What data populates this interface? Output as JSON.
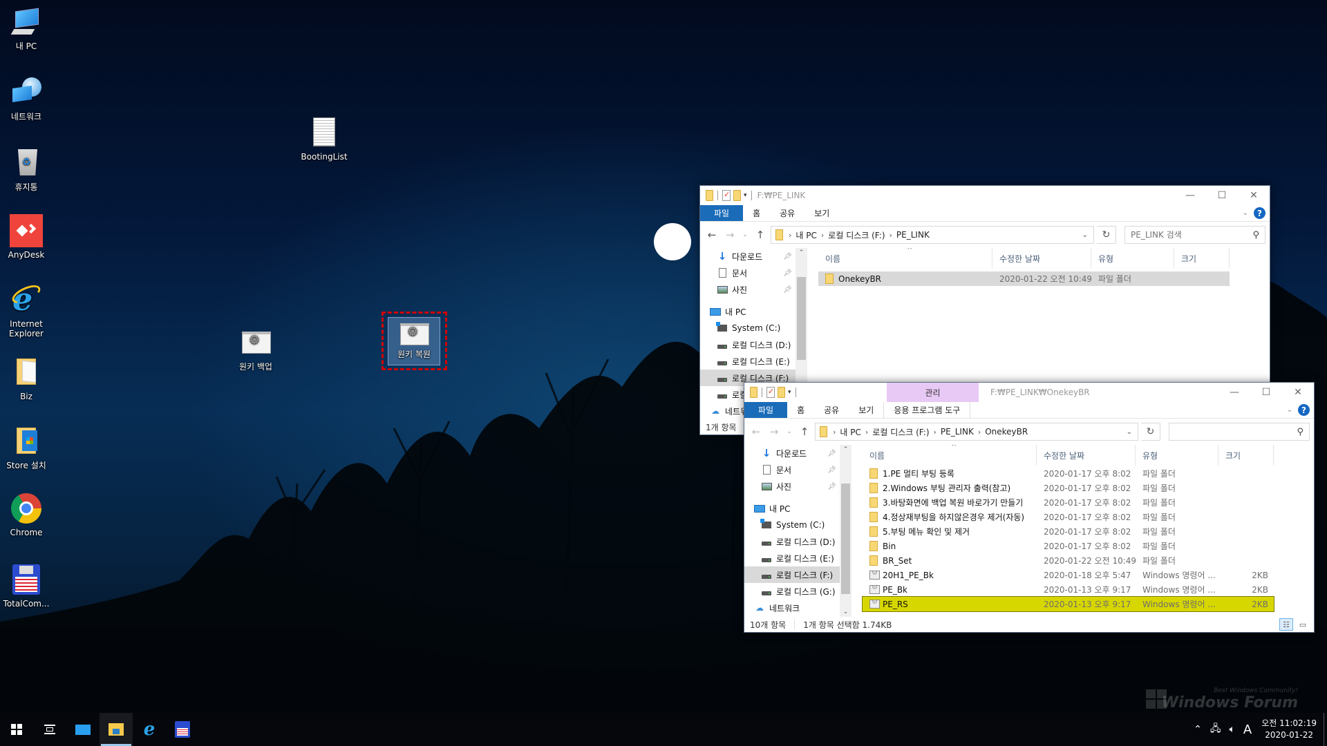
{
  "desktop": {
    "icons_left": [
      {
        "label": "내 PC",
        "icon": "this-pc-icon"
      },
      {
        "label": "네트워크",
        "icon": "network-icon"
      },
      {
        "label": "휴지통",
        "icon": "recycle-bin-icon"
      },
      {
        "label": "AnyDesk",
        "icon": "anydesk-icon"
      },
      {
        "label": "Internet Explorer",
        "icon": "internet-explorer-icon"
      },
      {
        "label": "Biz",
        "icon": "folder-icon"
      },
      {
        "label": "Store 설치",
        "icon": "store-folder-icon"
      },
      {
        "label": "Chrome",
        "icon": "chrome-icon"
      },
      {
        "label": "TotalCom...",
        "icon": "total-commander-icon"
      }
    ],
    "icons_free": [
      {
        "label": "BootingList",
        "icon": "text-file-icon"
      },
      {
        "label": "원키 백업",
        "icon": "batch-file-icon"
      },
      {
        "label": "원키 복원",
        "icon": "batch-file-icon",
        "selected": true
      }
    ]
  },
  "window1": {
    "title": "F:₩PE_LINK",
    "ribbon_tabs": [
      "파일",
      "홈",
      "공유",
      "보기"
    ],
    "breadcrumb": [
      "내 PC",
      "로컬 디스크 (F:)",
      "PE_LINK"
    ],
    "search_placeholder": "PE_LINK 검색",
    "nav_items": [
      {
        "label": "다운로드",
        "icon": "download-icon",
        "pinned": true
      },
      {
        "label": "문서",
        "icon": "documents-icon",
        "pinned": true
      },
      {
        "label": "사진",
        "icon": "pictures-icon",
        "pinned": true
      },
      {
        "label": "내 PC",
        "icon": "this-pc-icon"
      },
      {
        "label": "System (C:)",
        "icon": "system-drive-icon"
      },
      {
        "label": "로컬 디스크 (D:)",
        "icon": "drive-icon"
      },
      {
        "label": "로컬 디스크 (E:)",
        "icon": "drive-icon"
      },
      {
        "label": "로컬 디스크 (F:)",
        "icon": "drive-icon",
        "selected": true
      },
      {
        "label": "로컬 디스크 (G:)",
        "icon": "drive-icon"
      },
      {
        "label": "네트워크",
        "icon": "network-icon"
      }
    ],
    "columns": [
      "이름",
      "수정한 날짜",
      "유형",
      "크기"
    ],
    "rows": [
      {
        "name": "OnekeyBR",
        "date": "2020-01-22 오전 10:49",
        "type": "파일 폴더",
        "size": "",
        "kind": "folder"
      }
    ],
    "status": "1개 항목"
  },
  "window2": {
    "title": "F:₩PE_LINK₩OnekeyBR",
    "context_tab_group": "관리",
    "ribbon_tabs": [
      "파일",
      "홈",
      "공유",
      "보기"
    ],
    "context_tab": "응용 프로그램 도구",
    "breadcrumb": [
      "내 PC",
      "로컬 디스크 (F:)",
      "PE_LINK",
      "OnekeyBR"
    ],
    "search_placeholder": "",
    "nav_items": [
      {
        "label": "다운로드",
        "icon": "download-icon",
        "pinned": true
      },
      {
        "label": "문서",
        "icon": "documents-icon",
        "pinned": true
      },
      {
        "label": "사진",
        "icon": "pictures-icon",
        "pinned": true
      },
      {
        "label": "내 PC",
        "icon": "this-pc-icon"
      },
      {
        "label": "System (C:)",
        "icon": "system-drive-icon"
      },
      {
        "label": "로컬 디스크 (D:)",
        "icon": "drive-icon"
      },
      {
        "label": "로컬 디스크 (E:)",
        "icon": "drive-icon"
      },
      {
        "label": "로컬 디스크 (F:)",
        "icon": "drive-icon",
        "selected": true
      },
      {
        "label": "로컬 디스크 (G:)",
        "icon": "drive-icon"
      },
      {
        "label": "네트워크",
        "icon": "network-icon"
      }
    ],
    "columns": [
      "이름",
      "수정한 날짜",
      "유형",
      "크기"
    ],
    "rows": [
      {
        "name": "1.PE 멀티 부팅 등록",
        "date": "2020-01-17 오후 8:02",
        "type": "파일 폴더",
        "size": "",
        "kind": "folder"
      },
      {
        "name": "2.Windows 부팅 관리자 출력(참고)",
        "date": "2020-01-17 오후 8:02",
        "type": "파일 폴더",
        "size": "",
        "kind": "folder"
      },
      {
        "name": "3.바탕화면에 백업 복원 바로가기 만들기",
        "date": "2020-01-17 오후 8:02",
        "type": "파일 폴더",
        "size": "",
        "kind": "folder"
      },
      {
        "name": "4.정상재부팅을 하지않은경우 제거(자동)",
        "date": "2020-01-17 오후 8:02",
        "type": "파일 폴더",
        "size": "",
        "kind": "folder"
      },
      {
        "name": "5.부팅 메뉴 확인 및 제거",
        "date": "2020-01-17 오후 8:02",
        "type": "파일 폴더",
        "size": "",
        "kind": "folder"
      },
      {
        "name": "Bin",
        "date": "2020-01-17 오후 8:02",
        "type": "파일 폴더",
        "size": "",
        "kind": "folder"
      },
      {
        "name": "BR_Set",
        "date": "2020-01-22 오전 10:49",
        "type": "파일 폴더",
        "size": "",
        "kind": "folder"
      },
      {
        "name": "20H1_PE_Bk",
        "date": "2020-01-18 오후 5:47",
        "type": "Windows 명령어 ...",
        "size": "2KB",
        "kind": "cmd"
      },
      {
        "name": "PE_Bk",
        "date": "2020-01-13 오후 9:17",
        "type": "Windows 명령어 ...",
        "size": "2KB",
        "kind": "cmd"
      },
      {
        "name": "PE_RS",
        "date": "2020-01-13 오후 9:17",
        "type": "Windows 명령어 ...",
        "size": "2KB",
        "kind": "cmd",
        "selected": true
      }
    ],
    "status_count": "10개 항목",
    "status_selection": "1개 항목 선택함 1.74KB"
  },
  "taskbar": {
    "buttons": [
      "start-icon",
      "task-view-icon",
      "show-desktop-app-icon",
      "file-explorer-icon",
      "internet-explorer-icon",
      "total-commander-icon"
    ],
    "active": "file-explorer-icon",
    "tray_ime": "A",
    "clock_time": "오전 11:02:19",
    "clock_date": "2020-01-22"
  },
  "watermark": {
    "tagline": "Best Windows Community!",
    "name": "Windows Forum"
  },
  "colors": {
    "accent": "#1a6cb9",
    "selection_highlight": "#d7d700",
    "manage_tab": "#e8c8f4",
    "marker_outline": "#d40000"
  }
}
